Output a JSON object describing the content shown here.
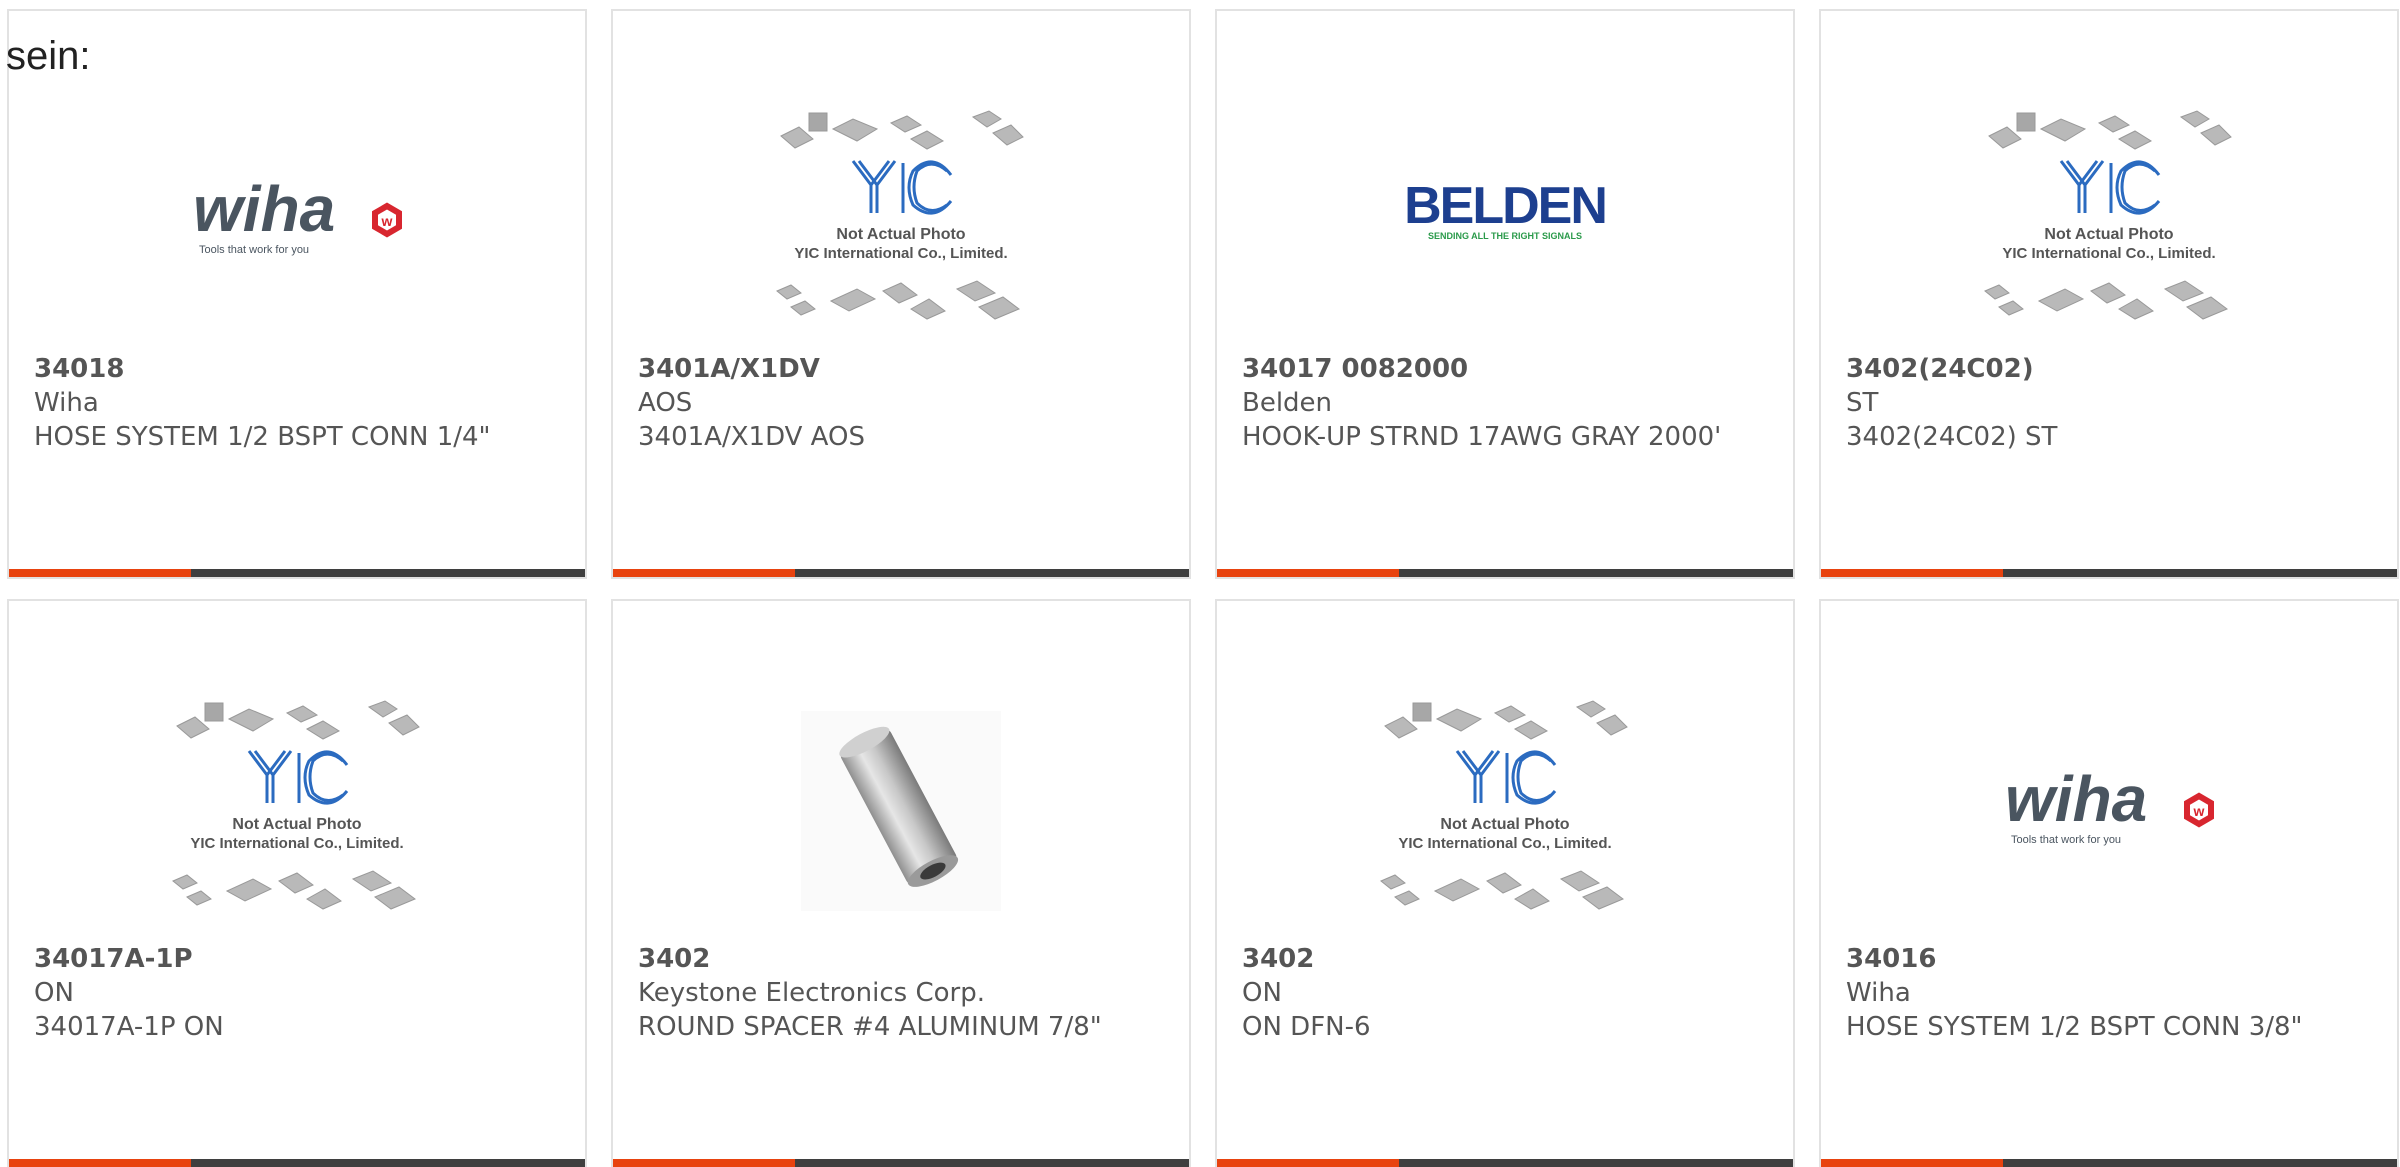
{
  "intro_text": "sein:",
  "products": [
    {
      "part_number": "34018",
      "manufacturer": "Wiha",
      "description": "HOSE SYSTEM 1/2 BSPT CONN 1/4\"",
      "image": "wiha-logo",
      "logo_text": "wiha",
      "logo_tagline": "Tools that work for you"
    },
    {
      "part_number": "3401A/X1DV",
      "manufacturer": "AOS",
      "description": "3401A/X1DV AOS",
      "image": "yic-placeholder",
      "placeholder_line1": "Not Actual Photo",
      "placeholder_line2": "YIC International Co., Limited."
    },
    {
      "part_number": "34017 0082000",
      "manufacturer": "Belden",
      "description": "HOOK-UP STRND 17AWG GRAY 2000'",
      "image": "belden-logo",
      "logo_text": "BELDEN",
      "logo_tagline": "SENDING ALL THE RIGHT SIGNALS"
    },
    {
      "part_number": "3402(24C02)",
      "manufacturer": "ST",
      "description": "3402(24C02) ST",
      "image": "yic-placeholder",
      "placeholder_line1": "Not Actual Photo",
      "placeholder_line2": "YIC International Co., Limited."
    },
    {
      "part_number": "34017A-1P",
      "manufacturer": "ON",
      "description": "34017A-1P ON",
      "image": "yic-placeholder",
      "placeholder_line1": "Not Actual Photo",
      "placeholder_line2": "YIC International Co., Limited."
    },
    {
      "part_number": "3402",
      "manufacturer": "Keystone Electronics Corp.",
      "description": "ROUND SPACER #4 ALUMINUM 7/8\"",
      "image": "spacer-photo"
    },
    {
      "part_number": "3402",
      "manufacturer": "ON",
      "description": "ON DFN-6",
      "image": "yic-placeholder",
      "placeholder_line1": "Not Actual Photo",
      "placeholder_line2": "YIC International Co., Limited."
    },
    {
      "part_number": "34016",
      "manufacturer": "Wiha",
      "description": "HOSE SYSTEM 1/2 BSPT CONN 3/8\"",
      "image": "wiha-logo",
      "logo_text": "wiha",
      "logo_tagline": "Tools that work for you"
    }
  ],
  "colors": {
    "accent": "#e8430f",
    "bar": "#3f3f3f",
    "border": "#e2e2e2",
    "text": "#555555",
    "wiha_gray": "#4a5560",
    "wiha_red": "#d8262f",
    "belden_blue": "#1d3f8f",
    "belden_green": "#2a9a4a",
    "yic_blue": "#2b6bc0"
  }
}
